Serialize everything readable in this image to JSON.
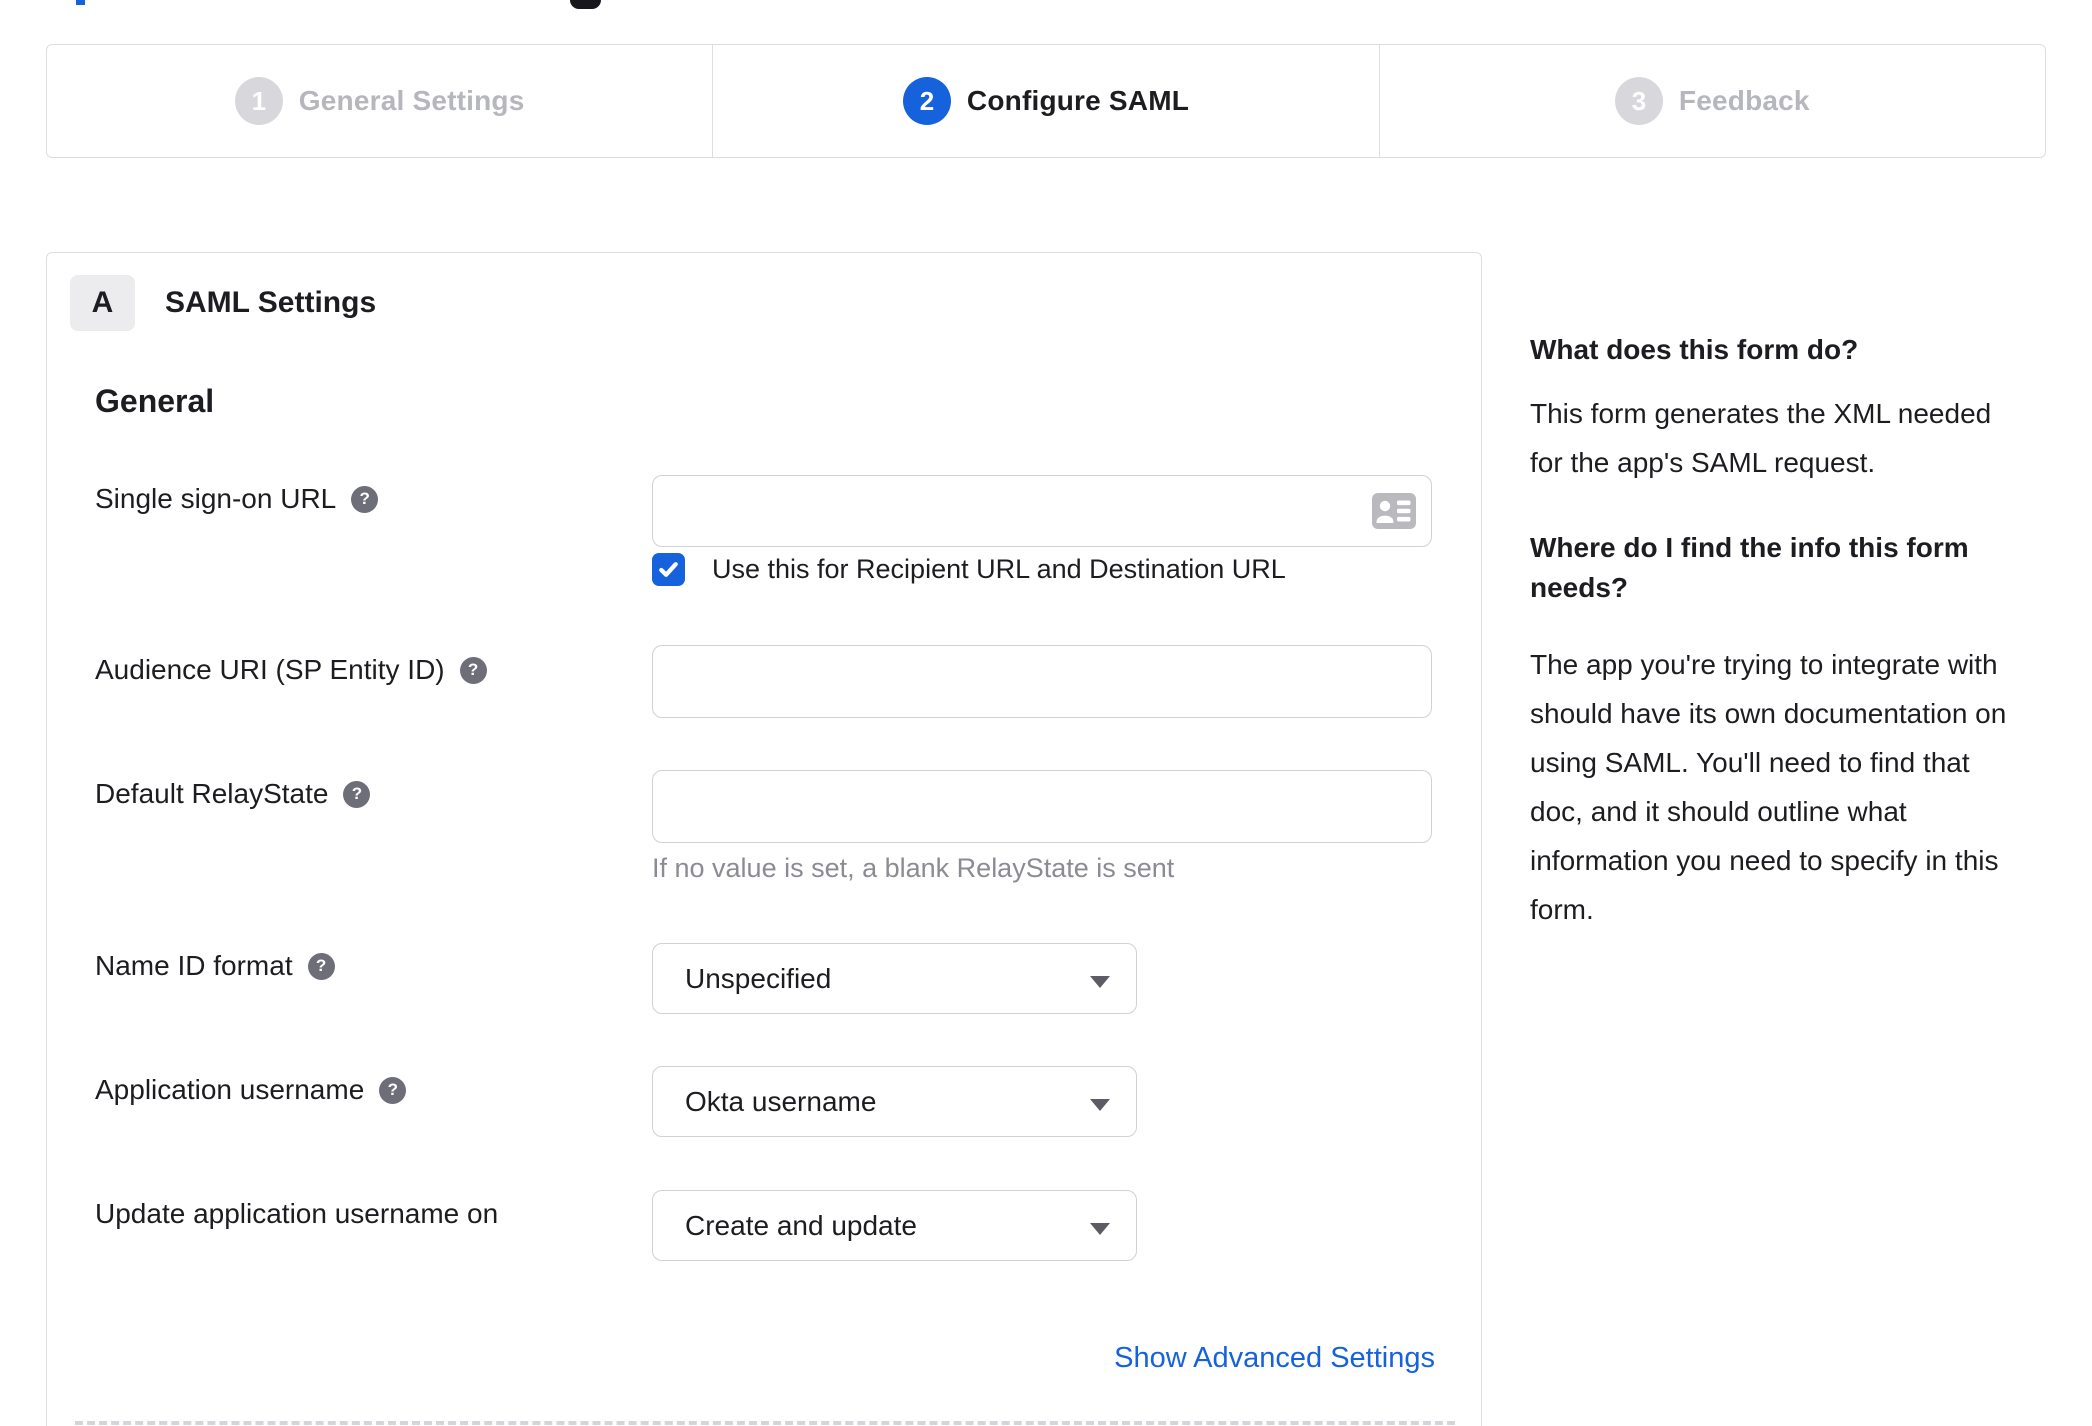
{
  "colors": {
    "accent_blue": "#1662dd",
    "text_dark": "#1d1d21",
    "inactive_gray": "#b6b6bd",
    "help_icon_gray": "#6e6e78",
    "border_gray": "#d1d1d6",
    "hint_gray": "#8b8b93"
  },
  "icons": {
    "help_glyph": "?"
  },
  "stepper": {
    "steps": [
      {
        "number": "1",
        "label": "General Settings",
        "state": "inactive"
      },
      {
        "number": "2",
        "label": "Configure SAML",
        "state": "active"
      },
      {
        "number": "3",
        "label": "Feedback",
        "state": "inactive"
      }
    ]
  },
  "form": {
    "section_badge": "A",
    "section_title": "SAML Settings",
    "group_heading": "General",
    "sso": {
      "label": "Single sign-on URL",
      "value": "",
      "checkbox_label": "Use this for Recipient URL and Destination URL",
      "checkbox_checked": true
    },
    "audience": {
      "label": "Audience URI (SP Entity ID)",
      "value": ""
    },
    "relay": {
      "label": "Default RelayState",
      "value": "",
      "hint": "If no value is set, a blank RelayState is sent"
    },
    "name_id": {
      "label": "Name ID format",
      "value": "Unspecified"
    },
    "app_username": {
      "label": "Application username",
      "value": "Okta username"
    },
    "update_username": {
      "label": "Update application username on",
      "value": "Create and update"
    },
    "advanced_link": "Show Advanced Settings"
  },
  "sidebar": {
    "q1_title": "What does this form do?",
    "q1_body": "This form generates the XML needed\nfor the app's SAML request.",
    "q2_title": "Where do I find the info this form\nneeds?",
    "q2_body": "The app you're trying to integrate with\nshould have its own documentation on\nusing SAML. You'll need to find that\ndoc, and it should outline what\ninformation you need to specify in this\nform."
  }
}
